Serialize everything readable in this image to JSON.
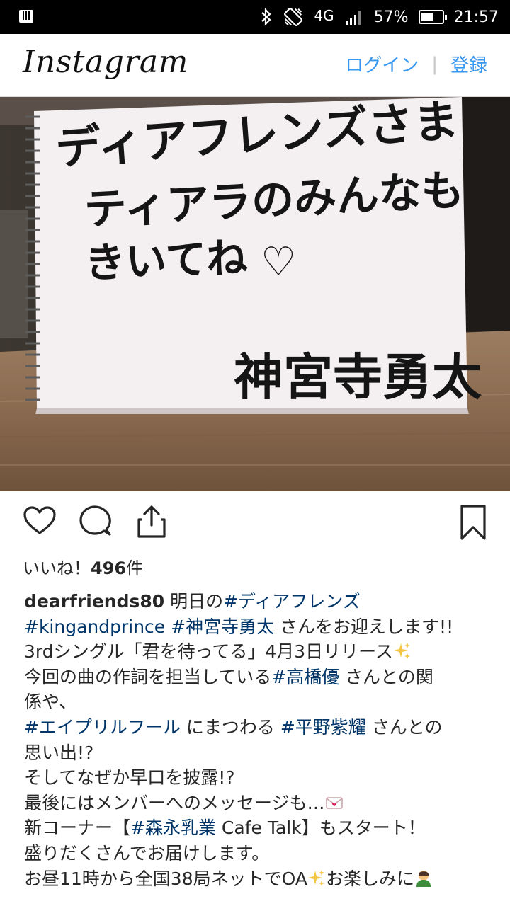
{
  "status_bar": {
    "network": "4G",
    "battery_percent": "57%",
    "battery_level": 0.57,
    "time": "21:57",
    "icons": [
      "notification-icon",
      "bluetooth-icon",
      "vibrate-icon",
      "signal-icon",
      "battery-icon"
    ]
  },
  "header": {
    "logo": "Instagram",
    "login": "ログイン",
    "separator": "|",
    "signup": "登録"
  },
  "post": {
    "image_alt": "ディアフレンズさま ティアラのみんなも きいてね 神宮寺勇太",
    "image_text": {
      "line1": "ディアフレンズさま",
      "line2": "ティアラのみんなも",
      "line3": "きいてね",
      "signature": "神宮寺勇太"
    },
    "actions": {
      "like": "heart-icon",
      "comment": "comment-icon",
      "share": "share-icon",
      "save": "bookmark-icon"
    },
    "likes_label": "いいね！",
    "likes_count": "496",
    "likes_unit": "件",
    "caption": {
      "username": "dearfriends80",
      "l1_text": " 明日の",
      "l1_tag": "#ディアフレンズ",
      "l2_tag1": "#kingandprince",
      "l2_tag2": "#神宮寺勇太",
      "l2_text": " さんをお迎えします!!",
      "l3_text": "3rdシングル「君を待ってる」4月3日リリース",
      "l4_text": "今回の曲の作詞を担当している",
      "l4_tag": "#高橋優",
      "l4_text2": " さんとの関",
      "l5_text": "係や、",
      "l6_tag1": "#エイプリルフール",
      "l6_text": " にまつわる ",
      "l6_tag2": "#平野紫耀",
      "l6_text2": " さんとの",
      "l7_text": "思い出!?",
      "l8_text": "そしてなぜか早口を披露!?",
      "l9_text": "最後にはメンバーへのメッセージも…",
      "l10_text": "新コーナー【",
      "l10_tag": "#森永乳業",
      "l10_text2": " Cafe Talk】もスタート！",
      "l11_text": "盛りだくさんでお届けします。",
      "l12_text": "お昼11時から全国38局ネットでOA",
      "l12_text2": "お楽しみに"
    },
    "emojis": [
      "sparkles-emoji",
      "love-letter-emoji",
      "man-bowing-emoji"
    ]
  }
}
